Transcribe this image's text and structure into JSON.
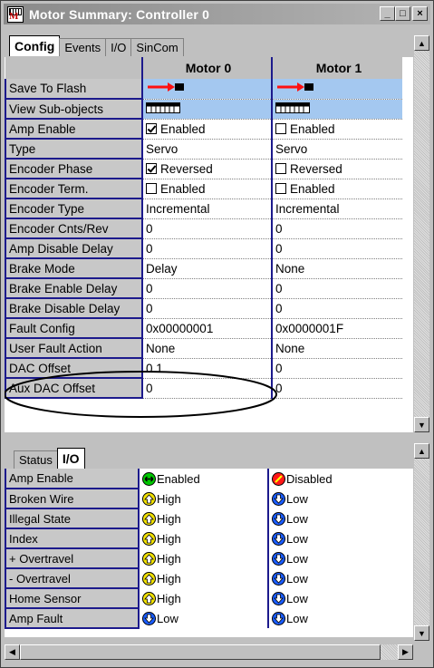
{
  "window": {
    "title": "Motor Summary: Controller 0",
    "app_icon": "motion-grid-icon",
    "buttons": {
      "minimize": "_",
      "maximize": "□",
      "close": "×"
    }
  },
  "config": {
    "tabs": [
      {
        "label": "Config",
        "active": true
      },
      {
        "label": "Events",
        "active": false
      },
      {
        "label": "I/O",
        "active": false
      },
      {
        "label": "SinCom",
        "active": false
      }
    ],
    "columns": [
      "Motor 0",
      "Motor 1"
    ],
    "rows": [
      {
        "label": "Save To Flash",
        "kind": "icon",
        "icon": "save-arrow-icon",
        "values": [
          "",
          ""
        ]
      },
      {
        "label": "View Sub-objects",
        "kind": "icon",
        "icon": "sub-objects-icon",
        "values": [
          "",
          ""
        ]
      },
      {
        "label": "Amp Enable",
        "kind": "check",
        "checked": [
          true,
          false
        ],
        "values": [
          "Enabled",
          "Enabled"
        ]
      },
      {
        "label": "Type",
        "kind": "text",
        "values": [
          "Servo",
          "Servo"
        ]
      },
      {
        "label": "Encoder Phase",
        "kind": "check",
        "checked": [
          true,
          false
        ],
        "values": [
          "Reversed",
          "Reversed"
        ]
      },
      {
        "label": "Encoder Term.",
        "kind": "check",
        "checked": [
          false,
          false
        ],
        "values": [
          "Enabled",
          "Enabled"
        ]
      },
      {
        "label": "Encoder Type",
        "kind": "text",
        "values": [
          "Incremental",
          "Incremental"
        ]
      },
      {
        "label": "Encoder Cnts/Rev",
        "kind": "text",
        "values": [
          "0",
          "0"
        ]
      },
      {
        "label": "Amp Disable Delay",
        "kind": "text",
        "values": [
          "0",
          "0"
        ]
      },
      {
        "label": "Brake Mode",
        "kind": "text",
        "values": [
          "Delay",
          "None"
        ]
      },
      {
        "label": "Brake Enable Delay",
        "kind": "text",
        "values": [
          "0",
          "0"
        ]
      },
      {
        "label": "Brake Disable Delay",
        "kind": "text",
        "values": [
          "0",
          "0"
        ]
      },
      {
        "label": "Fault Config",
        "kind": "text",
        "values": [
          "0x00000001",
          "0x0000001F"
        ]
      },
      {
        "label": "User Fault Action",
        "kind": "text",
        "values": [
          "None",
          "None"
        ]
      },
      {
        "label": "DAC Offset",
        "kind": "text",
        "values": [
          "0.1",
          "0"
        ]
      },
      {
        "label": "Aux DAC Offset",
        "kind": "text",
        "values": [
          "0",
          "0"
        ]
      }
    ]
  },
  "io": {
    "tabs": [
      {
        "label": "Status",
        "active": false
      },
      {
        "label": "I/O",
        "active": true
      }
    ],
    "rows": [
      {
        "label": "Amp Enable",
        "leds": [
          "green",
          "red"
        ],
        "values": [
          "Enabled",
          "Disabled"
        ]
      },
      {
        "label": "Broken Wire",
        "leds": [
          "yellow",
          "blue"
        ],
        "values": [
          "High",
          "Low"
        ]
      },
      {
        "label": "Illegal State",
        "leds": [
          "yellow",
          "blue"
        ],
        "values": [
          "High",
          "Low"
        ]
      },
      {
        "label": "Index",
        "leds": [
          "yellow",
          "blue"
        ],
        "values": [
          "High",
          "Low"
        ]
      },
      {
        "label": "+ Overtravel",
        "leds": [
          "yellow",
          "blue"
        ],
        "values": [
          "High",
          "Low"
        ]
      },
      {
        "label": "- Overtravel",
        "leds": [
          "yellow",
          "blue"
        ],
        "values": [
          "High",
          "Low"
        ]
      },
      {
        "label": "Home Sensor",
        "leds": [
          "yellow",
          "blue"
        ],
        "values": [
          "High",
          "Low"
        ]
      },
      {
        "label": "Amp Fault",
        "leds": [
          "blue",
          "blue"
        ],
        "values": [
          "Low",
          "Low"
        ]
      }
    ]
  },
  "colors": {
    "grid_blue": "#1c1a8c",
    "highlight_blue": "#a4c8f0",
    "annotation": "#000000"
  }
}
